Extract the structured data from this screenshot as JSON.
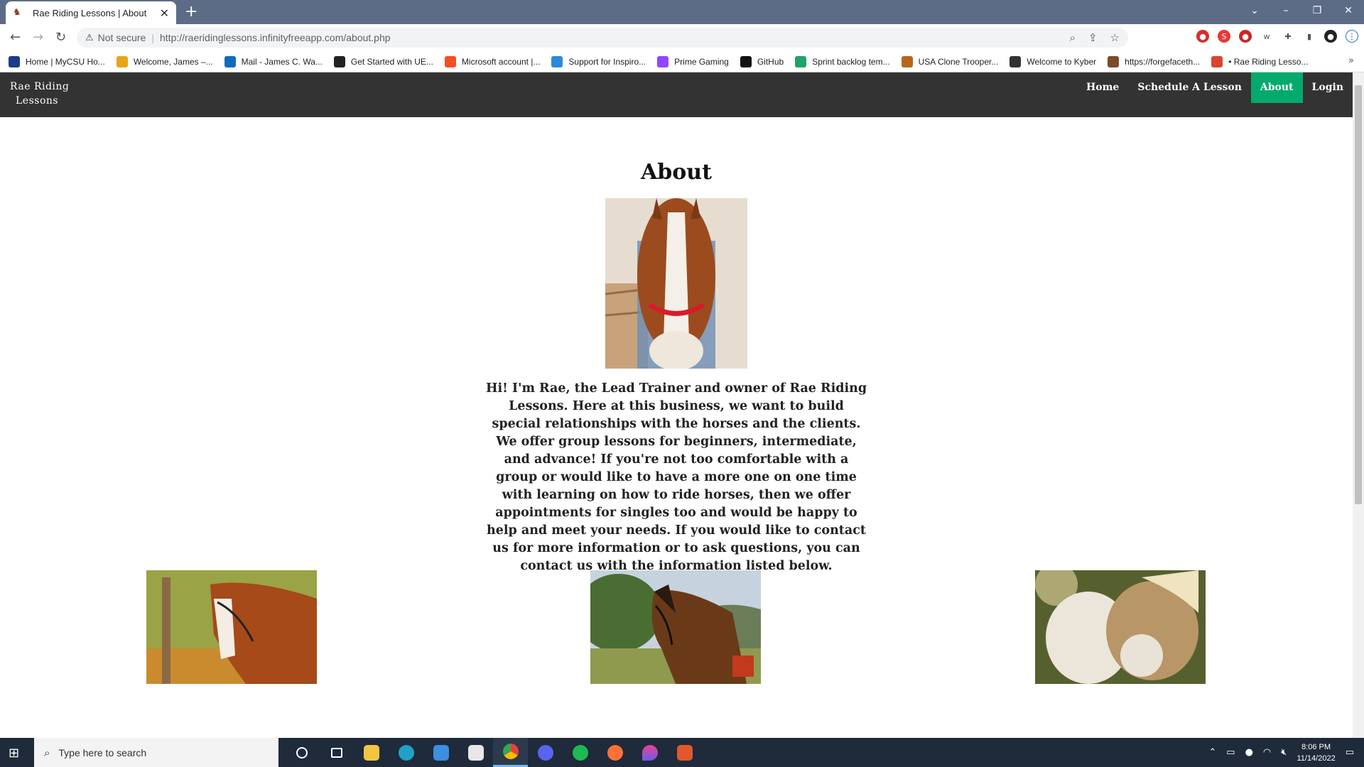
{
  "browser": {
    "tab_title": "Rae Riding Lessons | About",
    "not_secure": "Not secure",
    "url": "http://raeridinglessons.infinityfreeapp.com/about.php",
    "bookmarks": [
      {
        "label": "Home | MyCSU Ho...",
        "color": "#1a3c8a"
      },
      {
        "label": "Welcome, James –...",
        "color": "#e8a51a"
      },
      {
        "label": "Mail - James C. Wa...",
        "color": "#0f6cbd"
      },
      {
        "label": "Get Started with UE...",
        "color": "#222222"
      },
      {
        "label": "Microsoft account |...",
        "color": "#f25022"
      },
      {
        "label": "Support for Inspiro...",
        "color": "#2c8ad8"
      },
      {
        "label": "Prime Gaming",
        "color": "#9146ff"
      },
      {
        "label": "GitHub",
        "color": "#111111"
      },
      {
        "label": "Sprint backlog tem...",
        "color": "#21a366"
      },
      {
        "label": "USA Clone Trooper...",
        "color": "#b5651d"
      },
      {
        "label": "Welcome to Kyber",
        "color": "#333333"
      },
      {
        "label": "https://forgefaceth...",
        "color": "#7a4b2a"
      },
      {
        "label": "• Rae Riding Lesso...",
        "color": "#d9442e"
      }
    ]
  },
  "site": {
    "logo_line1": "Rae Riding",
    "logo_line2": "Lessons",
    "nav": {
      "home": "Home",
      "schedule": "Schedule A Lesson",
      "about": "About",
      "login": "Login"
    },
    "accent": "#04aa6d"
  },
  "main": {
    "title": "About",
    "blurb": "Hi! I'm Rae, the Lead Trainer and owner of Rae Riding Lessons. Here at this business, we want to build special relationships with the horses and the clients. We offer group lessons for beginners, intermediate, and advance! If you're not too comfortable with a group or would like to have a more one on one time with learning on how to ride horses, then we offer appointments for singles too and would be happy to help and meet your needs. If you would like to contact us for more information or to ask questions, you can contact us with the information listed below."
  },
  "taskbar": {
    "search_placeholder": "Type here to search",
    "time": "8:06 PM",
    "date": "11/14/2022"
  }
}
